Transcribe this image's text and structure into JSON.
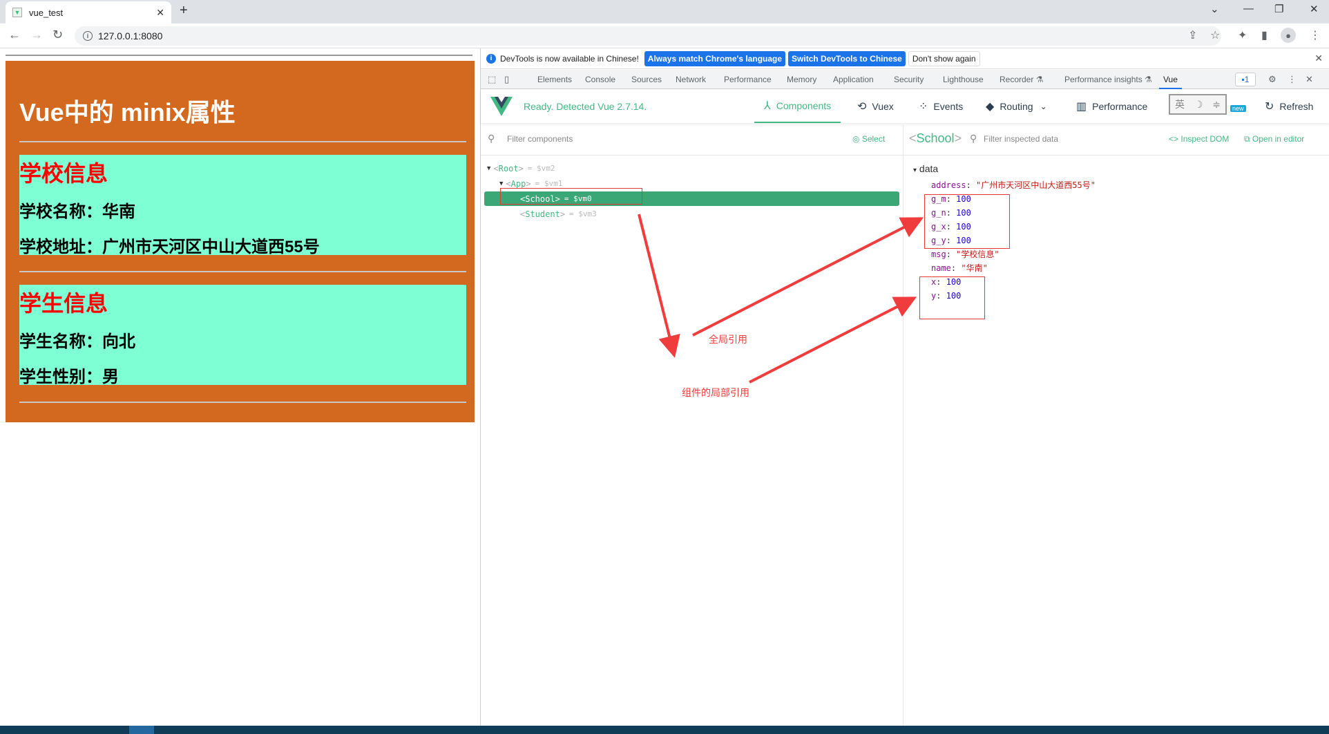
{
  "browser": {
    "tab_title": "vue_test",
    "new_tab_icon": "plus-icon",
    "url": "127.0.0.1:8080",
    "window_controls": [
      "chevron-down-icon",
      "minimize-icon",
      "restore-icon",
      "close-icon"
    ]
  },
  "page": {
    "title": "Vue中的 minix属性",
    "school": {
      "heading": "学校信息",
      "name_line": "学校名称：华南",
      "address_line": "学校地址：广州市天河区中山大道西55号"
    },
    "student": {
      "heading": "学生信息",
      "name_line": "学生名称：向北",
      "gender_line": "学生性别：男"
    },
    "colors": {
      "app_bg": "#d2691e",
      "card_bg": "#7fffd4",
      "heading": "#ff0000"
    }
  },
  "devtools": {
    "infobar": {
      "message": "DevTools is now available in Chinese!",
      "btn_match": "Always match Chrome's language",
      "btn_switch": "Switch DevTools to Chinese",
      "btn_dismiss": "Don't show again"
    },
    "tabs": [
      "Elements",
      "Console",
      "Sources",
      "Network",
      "Performance",
      "Memory",
      "Application",
      "Security",
      "Lighthouse",
      "Recorder ⚗",
      "Performance insights ⚗",
      "Vue"
    ],
    "active_tab": "Vue",
    "message_count": "1",
    "vue": {
      "status": "Ready. Detected Vue 2.7.14.",
      "nav": [
        "Components",
        "Vuex",
        "Events",
        "Routing",
        "Performance"
      ],
      "new_badge": "new",
      "refresh": "Refresh",
      "filter_components_placeholder": "Filter components",
      "select_label": "Select",
      "tree": [
        {
          "name": "Root",
          "vm": "= $vm2",
          "expanded": true
        },
        {
          "name": "App",
          "vm": "= $vm1",
          "expanded": true
        },
        {
          "name": "School",
          "vm": "= $vm0",
          "selected": true
        },
        {
          "name": "Student",
          "vm": "= $vm3"
        }
      ],
      "inspector": {
        "component": "School",
        "filter_placeholder": "Filter inspected data",
        "inspect_dom": "Inspect DOM",
        "open_in_editor": "Open in editor",
        "section": "data",
        "props": [
          {
            "key": "address",
            "value": "\"广州市天河区中山大道西55号\"",
            "type": "string"
          },
          {
            "key": "g_m",
            "value": "100",
            "type": "number"
          },
          {
            "key": "g_n",
            "value": "100",
            "type": "number"
          },
          {
            "key": "g_x",
            "value": "100",
            "type": "number"
          },
          {
            "key": "g_y",
            "value": "100",
            "type": "number"
          },
          {
            "key": "msg",
            "value": "\"学校信息\"",
            "type": "string"
          },
          {
            "key": "name",
            "value": "\"华南\"",
            "type": "string"
          },
          {
            "key": "x",
            "value": "100",
            "type": "number"
          },
          {
            "key": "y",
            "value": "100",
            "type": "number"
          }
        ]
      }
    }
  },
  "annotations": {
    "global_ref": "全局引用",
    "local_ref": "组件的局部引用",
    "color": "#f03c3c"
  }
}
